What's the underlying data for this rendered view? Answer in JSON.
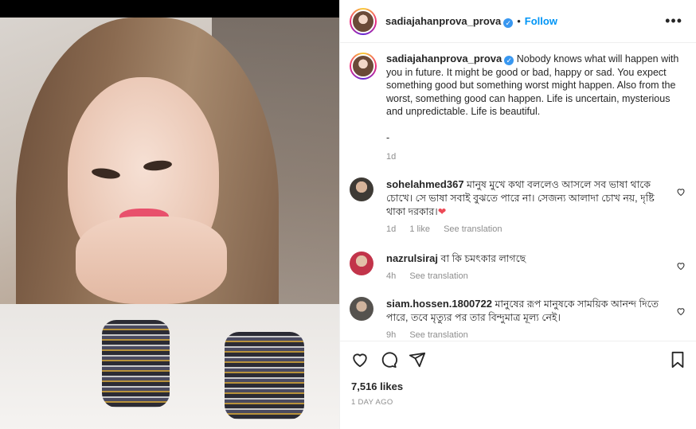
{
  "post": {
    "username": "sadiajahanprova_prova",
    "follow_label": "Follow",
    "separator": "•",
    "verified_glyph": "✓",
    "more_glyph": "•••"
  },
  "caption": {
    "username": "sadiajahanprova_prova",
    "text": "Nobody knows what will happen with you in future. It might be good or bad, happy or sad. You expect something good but something worst might happen. Also from the worst, something good can happen. Life is uncertain, mysterious and unpredictable. Life is beautiful.",
    "extra": "-",
    "time": "1d"
  },
  "comments": [
    {
      "username": "sohelahmed367",
      "text": "মানুষ মুখে কথা বললেও আসলে সব ভাষা থাকে চোখে। সে ভাষা সবাই বুঝতে পারে না। সেজন্য আলাদা চোখ নয়, দৃষ্টি থাকা দরকার।",
      "emoji": "❤",
      "time": "1d",
      "likes": "1 like",
      "translate": "See translation"
    },
    {
      "username": "nazrulsiraj",
      "text": "বা কি চমৎকার লাগছে",
      "time": "4h",
      "translate": "See translation"
    },
    {
      "username": "siam.hossen.1800722",
      "text": "মানুষের রূপ মানুষকে সাময়িক আনন্দ দিতে পারে, তবে মৃত্যুর পর তার বিন্দুমাত্র মূল্য নেই।",
      "time": "9h",
      "translate": "See translation"
    }
  ],
  "footer": {
    "likes": "7,516 likes",
    "date": "1 DAY AGO"
  },
  "icons": [
    "heart-icon",
    "comment-icon",
    "share-icon",
    "bookmark-icon",
    "more-icon",
    "verified-badge-icon"
  ],
  "colors": {
    "accent": "#0095f6",
    "verified": "#3897f0",
    "heart": "#ed4956",
    "muted": "#8e8e8e"
  }
}
